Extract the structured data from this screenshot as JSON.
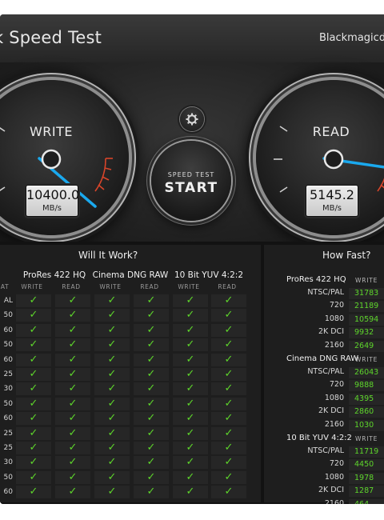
{
  "app": {
    "title": "k Speed Test",
    "brand": "Blackmagicdes"
  },
  "colors": {
    "accent_blue": "#1aa9ee",
    "check_green": "#5ed62b",
    "redline": "#d8452a"
  },
  "gauges": {
    "write": {
      "label": "WRITE",
      "value": "10400.0",
      "unit": "MB/s"
    },
    "read": {
      "label": "READ",
      "value": "5145.2",
      "unit": "MB/s"
    }
  },
  "controls": {
    "start_small": "SPEED TEST",
    "start_big": "START",
    "settings_icon": "gear-icon"
  },
  "will_it_work": {
    "title": "Will It Work?",
    "partial_header": "AT",
    "codecs": [
      "ProRes 422 HQ",
      "Cinema DNG RAW",
      "10 Bit YUV 4:2:2"
    ],
    "write_label": "WRITE",
    "read_label": "READ",
    "check_glyph": "✓",
    "fps": [
      "AL",
      "50",
      "60",
      "50",
      "60",
      "25",
      "30",
      "50",
      "60",
      "25",
      "25",
      "30",
      "50",
      "60"
    ]
  },
  "how_fast": {
    "title": "How Fast?",
    "write_label": "WRITE",
    "groups": [
      {
        "name": "ProRes 422 HQ",
        "rows": [
          {
            "res": "NTSC/PAL",
            "write": "31783"
          },
          {
            "res": "720",
            "write": "21189"
          },
          {
            "res": "1080",
            "write": "10594"
          },
          {
            "res": "2K DCI",
            "write": "9932"
          },
          {
            "res": "2160",
            "write": "2649"
          }
        ]
      },
      {
        "name": "Cinema DNG RAW",
        "rows": [
          {
            "res": "NTSC/PAL",
            "write": "26043"
          },
          {
            "res": "720",
            "write": "9888"
          },
          {
            "res": "1080",
            "write": "4395"
          },
          {
            "res": "2K DCI",
            "write": "2860"
          },
          {
            "res": "2160",
            "write": "1030"
          }
        ]
      },
      {
        "name": "10 Bit YUV 4:2:2",
        "rows": [
          {
            "res": "NTSC/PAL",
            "write": "11719"
          },
          {
            "res": "720",
            "write": "4450"
          },
          {
            "res": "1080",
            "write": "1978"
          },
          {
            "res": "2K DCI",
            "write": "1287"
          },
          {
            "res": "2160",
            "write": "464"
          }
        ]
      }
    ]
  }
}
